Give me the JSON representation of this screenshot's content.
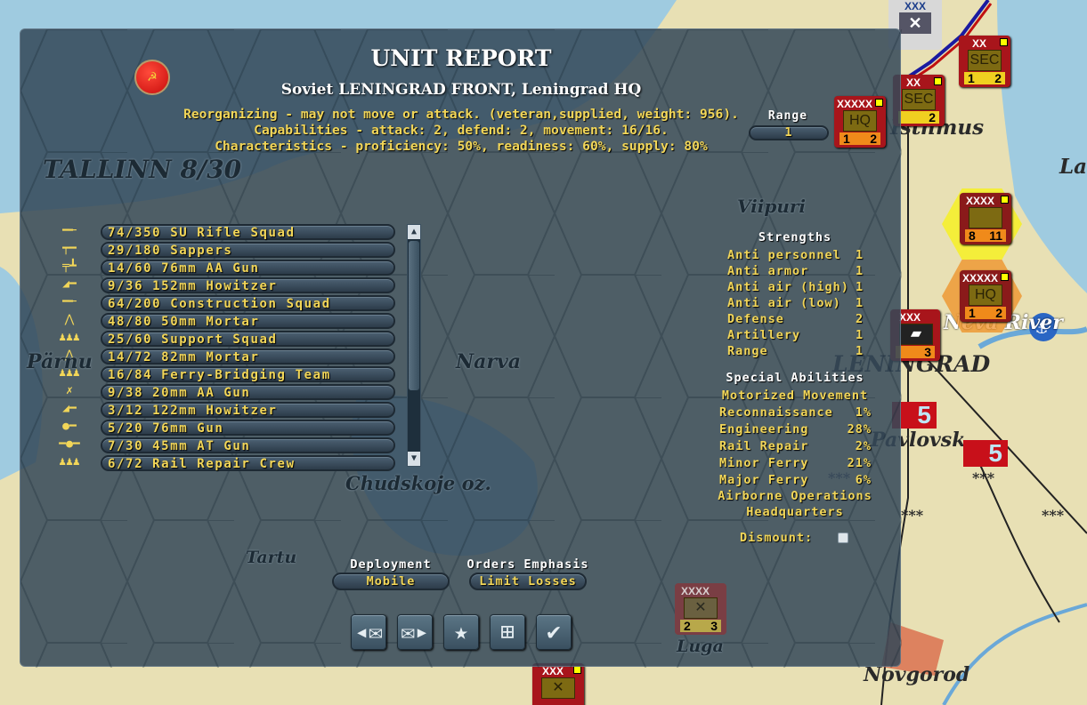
{
  "map": {
    "labels": [
      "TALLINN 8/30",
      "Pärnu",
      "Narva",
      "Chudskoje oz.",
      "Tartu",
      "Viipuri",
      "Isthmus",
      "La",
      "Neva River",
      "LENINGRAD",
      "Pavlovsk",
      "Novgorod",
      "Luga"
    ],
    "counters": [
      {
        "echelon": "XXXXX",
        "symbol": "HQ",
        "a": "1",
        "b": "2"
      },
      {
        "echelon": "XX",
        "symbol": "SEC",
        "a": "1",
        "b": "2"
      },
      {
        "echelon": "XX",
        "symbol": "SEC",
        "a": "",
        "b": "2"
      },
      {
        "echelon": "XXXX",
        "symbol": "",
        "a": "8",
        "b": "11"
      },
      {
        "echelon": "XXXXX",
        "symbol": "HQ",
        "a": "1",
        "b": "2"
      },
      {
        "echelon": "XXX",
        "symbol": "",
        "a": "",
        "b": "3"
      },
      {
        "echelon": "XXXX",
        "symbol": "",
        "a": "2",
        "b": "3"
      },
      {
        "echelon": "XXX",
        "symbol": "",
        "a": "",
        "b": ""
      }
    ],
    "victory_points": [
      "5",
      "5"
    ],
    "stars": [
      "***",
      "***",
      "***",
      "***"
    ]
  },
  "report": {
    "title": "UNIT REPORT",
    "subtitle": "Soviet LENINGRAD FRONT, Leningrad HQ",
    "status_line": "Reorganizing - may not move or attack. (veteran,supplied, weight: 956).",
    "capabilities_line": "Capabilities - attack: 2, defend: 2, movement: 16/16.",
    "characteristics_line": "Characteristics - proficiency: 50%, readiness: 60%, supply: 80%",
    "range_label": "Range",
    "range_value": "1",
    "squads": [
      {
        "icon": "rifle",
        "text": "74/350 SU Rifle Squad"
      },
      {
        "icon": "smg",
        "text": "29/180 Sappers"
      },
      {
        "icon": "aa-gun",
        "text": "14/60 76mm AA Gun"
      },
      {
        "icon": "howitzer",
        "text": "9/36 152mm Howitzer"
      },
      {
        "icon": "rifle",
        "text": "64/200 Construction Squad"
      },
      {
        "icon": "mortar",
        "text": "48/80 50mm Mortar"
      },
      {
        "icon": "support",
        "text": "25/60 Support Squad"
      },
      {
        "icon": "mortar",
        "text": "14/72 82mm Mortar"
      },
      {
        "icon": "engineers",
        "text": "16/84 Ferry-Bridging Team"
      },
      {
        "icon": "light-aa",
        "text": "9/38 20mm AA Gun"
      },
      {
        "icon": "howitzer",
        "text": "3/12 122mm Howitzer"
      },
      {
        "icon": "field-gun",
        "text": "5/20 76mm Gun"
      },
      {
        "icon": "at-gun",
        "text": "7/30 45mm AT Gun"
      },
      {
        "icon": "engineers",
        "text": "6/72 Rail Repair Crew"
      }
    ],
    "strengths_title": "Strengths",
    "strengths": [
      {
        "label": "Anti personnel",
        "value": "1"
      },
      {
        "label": "Anti armor",
        "value": "1"
      },
      {
        "label": "Anti air (high)",
        "value": "1"
      },
      {
        "label": "Anti air (low)",
        "value": "1"
      },
      {
        "label": "Defense",
        "value": "2"
      },
      {
        "label": "Artillery",
        "value": "1"
      },
      {
        "label": "Range",
        "value": "1"
      }
    ],
    "abilities_title": "Special Abilities",
    "abilities_top": "Motorized Movement",
    "abilities": [
      {
        "label": "Reconnaissance",
        "value": "1%"
      },
      {
        "label": "Engineering",
        "value": "28%"
      },
      {
        "label": "Rail Repair",
        "value": "2%"
      },
      {
        "label": "Minor Ferry",
        "value": "21%"
      },
      {
        "label": "Major Ferry",
        "value": "6%"
      }
    ],
    "abilities_bottom": [
      "Airborne Operations",
      "Headquarters"
    ],
    "dismount_label": "Dismount:",
    "deployment_label": "Deployment",
    "deployment_value": "Mobile",
    "orders_label": "Orders Emphasis",
    "orders_value": "Limit Losses"
  }
}
